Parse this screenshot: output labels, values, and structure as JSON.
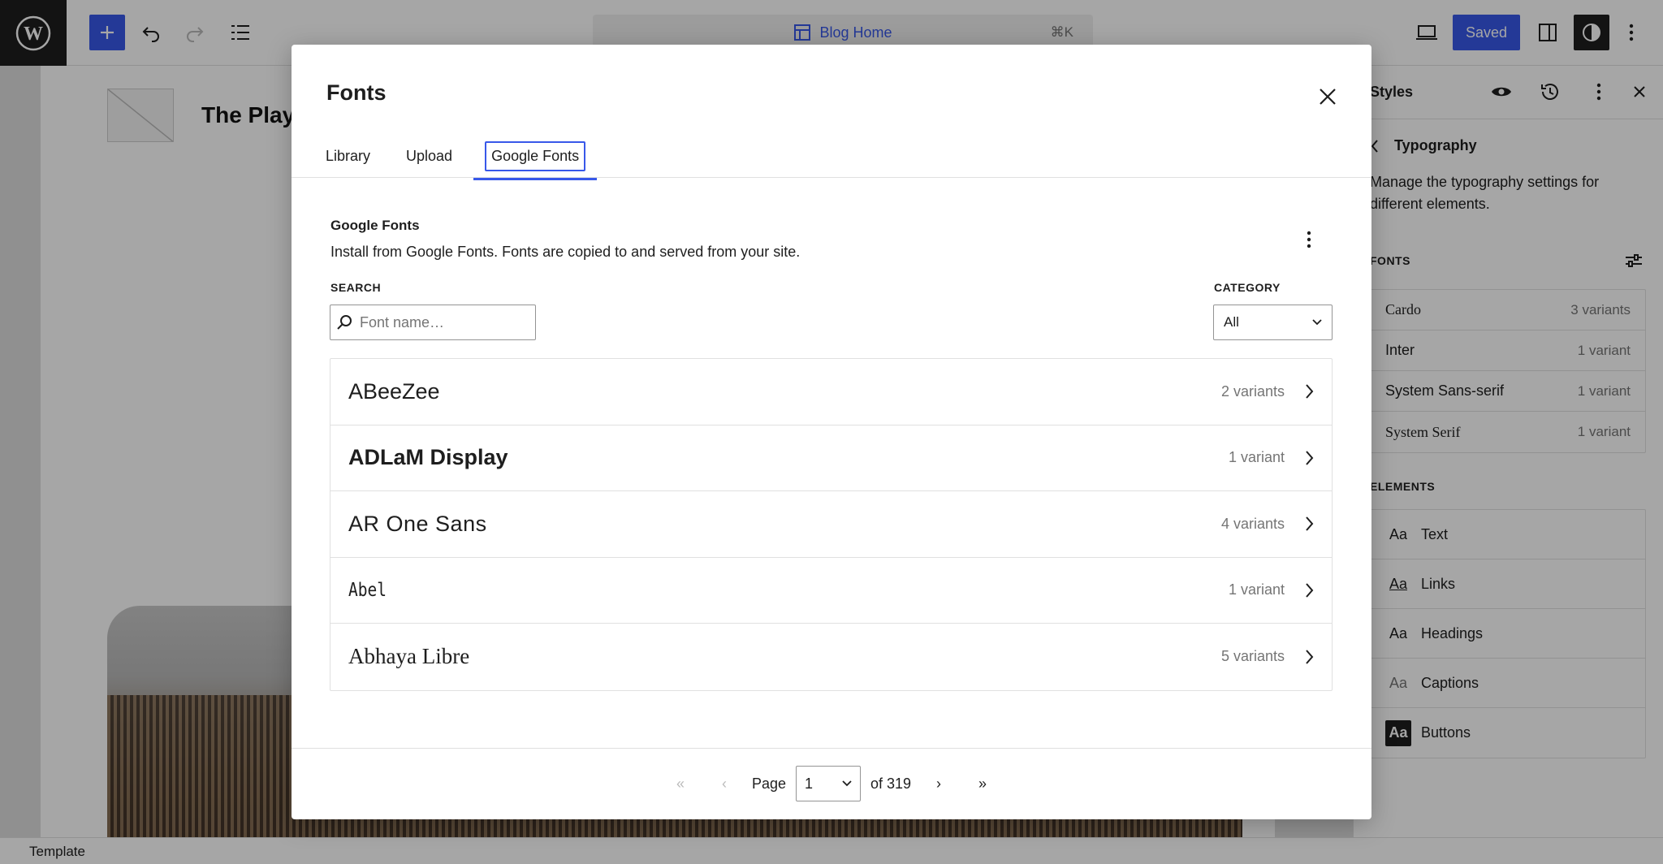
{
  "toolbar": {
    "command_title": "Blog Home",
    "command_shortcut": "⌘K",
    "saved_label": "Saved"
  },
  "canvas": {
    "site_title": "The Playground"
  },
  "statusbar": {
    "label": "Template"
  },
  "sidebar": {
    "title": "Styles",
    "panel_title": "Typography",
    "description": "Manage the typography settings for different elements.",
    "fonts_heading": "FONTS",
    "fonts": [
      {
        "name": "Cardo",
        "count": "3 variants"
      },
      {
        "name": "Inter",
        "count": "1 variant"
      },
      {
        "name": "System Sans-serif",
        "count": "1 variant"
      },
      {
        "name": "System Serif",
        "count": "1 variant"
      }
    ],
    "elements_heading": "ELEMENTS",
    "elements": [
      {
        "aa": "Aa",
        "label": "Text"
      },
      {
        "aa": "Aa",
        "label": "Links"
      },
      {
        "aa": "Aa",
        "label": "Headings"
      },
      {
        "aa": "Aa",
        "label": "Captions"
      },
      {
        "aa": "Aa",
        "label": "Buttons"
      }
    ]
  },
  "modal": {
    "title": "Fonts",
    "tabs": [
      "Library",
      "Upload",
      "Google Fonts"
    ],
    "active_tab": "Google Fonts",
    "section_title": "Google Fonts",
    "section_desc": "Install from Google Fonts. Fonts are copied to and served from your site.",
    "search_label": "SEARCH",
    "search_placeholder": "Font name…",
    "category_label": "CATEGORY",
    "category_value": "All",
    "results": [
      {
        "name": "ABeeZee",
        "count": "2 variants"
      },
      {
        "name": "ADLaM Display",
        "count": "1 variant"
      },
      {
        "name": "AR One Sans",
        "count": "4 variants"
      },
      {
        "name": "Abel",
        "count": "1 variant"
      },
      {
        "name": "Abhaya Libre",
        "count": "5 variants"
      }
    ],
    "pagination": {
      "first": "«",
      "prev": "‹",
      "page_label": "Page",
      "page_value": "1",
      "of_label": "of 319",
      "next": "›",
      "last": "»"
    }
  },
  "colors": {
    "accent": "#3858e9",
    "dark": "#1e1e1e",
    "muted": "#757575"
  }
}
